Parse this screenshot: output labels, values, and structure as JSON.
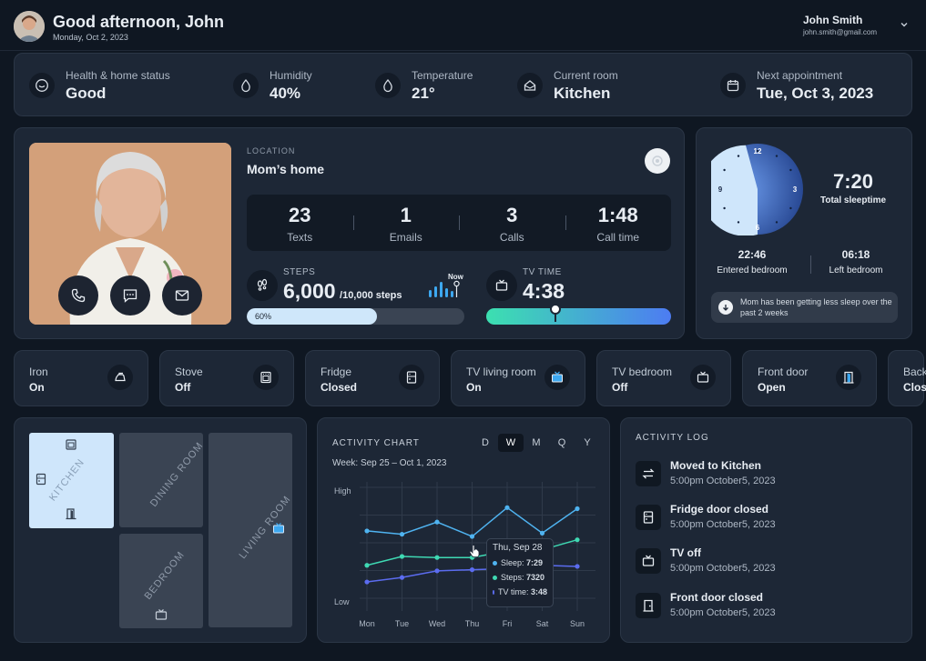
{
  "header": {
    "greeting": "Good afternoon, John",
    "date": "Monday, Oct 2, 2023",
    "user_name": "John Smith",
    "user_email": "john.smith@gmail.com"
  },
  "status": [
    {
      "label": "Health & home status",
      "value": "Good",
      "icon": "smile-icon"
    },
    {
      "label": "Humidity",
      "value": "40%",
      "icon": "droplet-icon"
    },
    {
      "label": "Temperature",
      "value": "21°",
      "icon": "droplet-icon"
    },
    {
      "label": "Current room",
      "value": "Kitchen",
      "icon": "home-icon"
    },
    {
      "label": "Next appointment",
      "value": "Tue, Oct 3, 2023",
      "icon": "calendar-icon"
    }
  ],
  "profile": {
    "location_label": "LOCATION",
    "location": "Mom’s home",
    "stats": [
      {
        "value": "23",
        "label": "Texts"
      },
      {
        "value": "1",
        "label": "Emails"
      },
      {
        "value": "3",
        "label": "Calls"
      },
      {
        "value": "1:48",
        "label": "Call time"
      }
    ],
    "steps_label": "STEPS",
    "steps_value": "6,000",
    "steps_goal": "/10,000 steps",
    "steps_progress_label": "60%",
    "steps_progress": 0.6,
    "now_label": "Now",
    "tv_label": "TV TIME",
    "tv_value": "4:38"
  },
  "sleep": {
    "total": "7:20",
    "total_label": "Total sleeptime",
    "entered": "22:46",
    "entered_label": "Entered bedroom",
    "left": "06:18",
    "left_label": "Left bedroom",
    "note": "Mom has been getting less sleep over the past 2 weeks",
    "clock_numbers": [
      "12",
      "3",
      "6",
      "9"
    ]
  },
  "devices": [
    {
      "label": "Iron",
      "value": "On",
      "icon": "iron-icon",
      "active": false
    },
    {
      "label": "Stove",
      "value": "Off",
      "icon": "stove-icon",
      "active": false
    },
    {
      "label": "Fridge",
      "value": "Closed",
      "icon": "fridge-icon",
      "active": false
    },
    {
      "label": "TV living room",
      "value": "On",
      "icon": "tv-icon",
      "active": true
    },
    {
      "label": "TV bedroom",
      "value": "Off",
      "icon": "tv-icon",
      "active": false
    },
    {
      "label": "Front door",
      "value": "Open",
      "icon": "door-icon",
      "active": true
    },
    {
      "label": "Back",
      "value": "Clos",
      "icon": "door-icon",
      "active": false
    }
  ],
  "floorplan": {
    "rooms": [
      "KITCHEN",
      "DINING ROOM",
      "LIVING ROOM",
      "BEDROOM"
    ]
  },
  "chart_data": {
    "type": "line",
    "title": "ACTIVITY CHART",
    "subtitle": "Week: Sep 25 – Oct 1, 2023",
    "tabs": [
      "D",
      "W",
      "M",
      "Q",
      "Y"
    ],
    "active_tab": "W",
    "categories": [
      "Mon",
      "Tue",
      "Wed",
      "Thu",
      "Fri",
      "Sat",
      "Sun"
    ],
    "y_tick_labels": [
      "High",
      "Low"
    ],
    "ylim": [
      0,
      1
    ],
    "series": [
      {
        "name": "Sleep",
        "color": "#4fb3f0",
        "values": [
          0.64,
          0.61,
          0.72,
          0.59,
          0.85,
          0.62,
          0.84
        ]
      },
      {
        "name": "Steps",
        "color": "#3fd9b3",
        "values": [
          0.33,
          0.41,
          0.4,
          0.4,
          0.46,
          0.47,
          0.56
        ]
      },
      {
        "name": "TV time",
        "color": "#5b6cf0",
        "values": [
          0.18,
          0.22,
          0.28,
          0.29,
          0.3,
          0.33,
          0.32
        ]
      }
    ],
    "grid": true,
    "tooltip": {
      "title": "Thu, Sep 28",
      "rows": [
        {
          "label": "Sleep:",
          "value": "7:29",
          "color": "#4fb3f0"
        },
        {
          "label": "Steps:",
          "value": "7320",
          "color": "#3fd9b3"
        },
        {
          "label": "TV time:",
          "value": "3:48",
          "color": "#5b6cf0"
        }
      ]
    }
  },
  "activity_log": {
    "title": "ACTIVITY LOG",
    "items": [
      {
        "title": "Moved to Kitchen",
        "time": "5:00pm October5, 2023",
        "icon": "arrows-icon"
      },
      {
        "title": "Fridge door closed",
        "time": "5:00pm October5, 2023",
        "icon": "fridge-icon"
      },
      {
        "title": "TV off",
        "time": "5:00pm October5, 2023",
        "icon": "tv-icon"
      },
      {
        "title": "Front door closed",
        "time": "5:00pm October5, 2023",
        "icon": "door-icon"
      }
    ]
  }
}
